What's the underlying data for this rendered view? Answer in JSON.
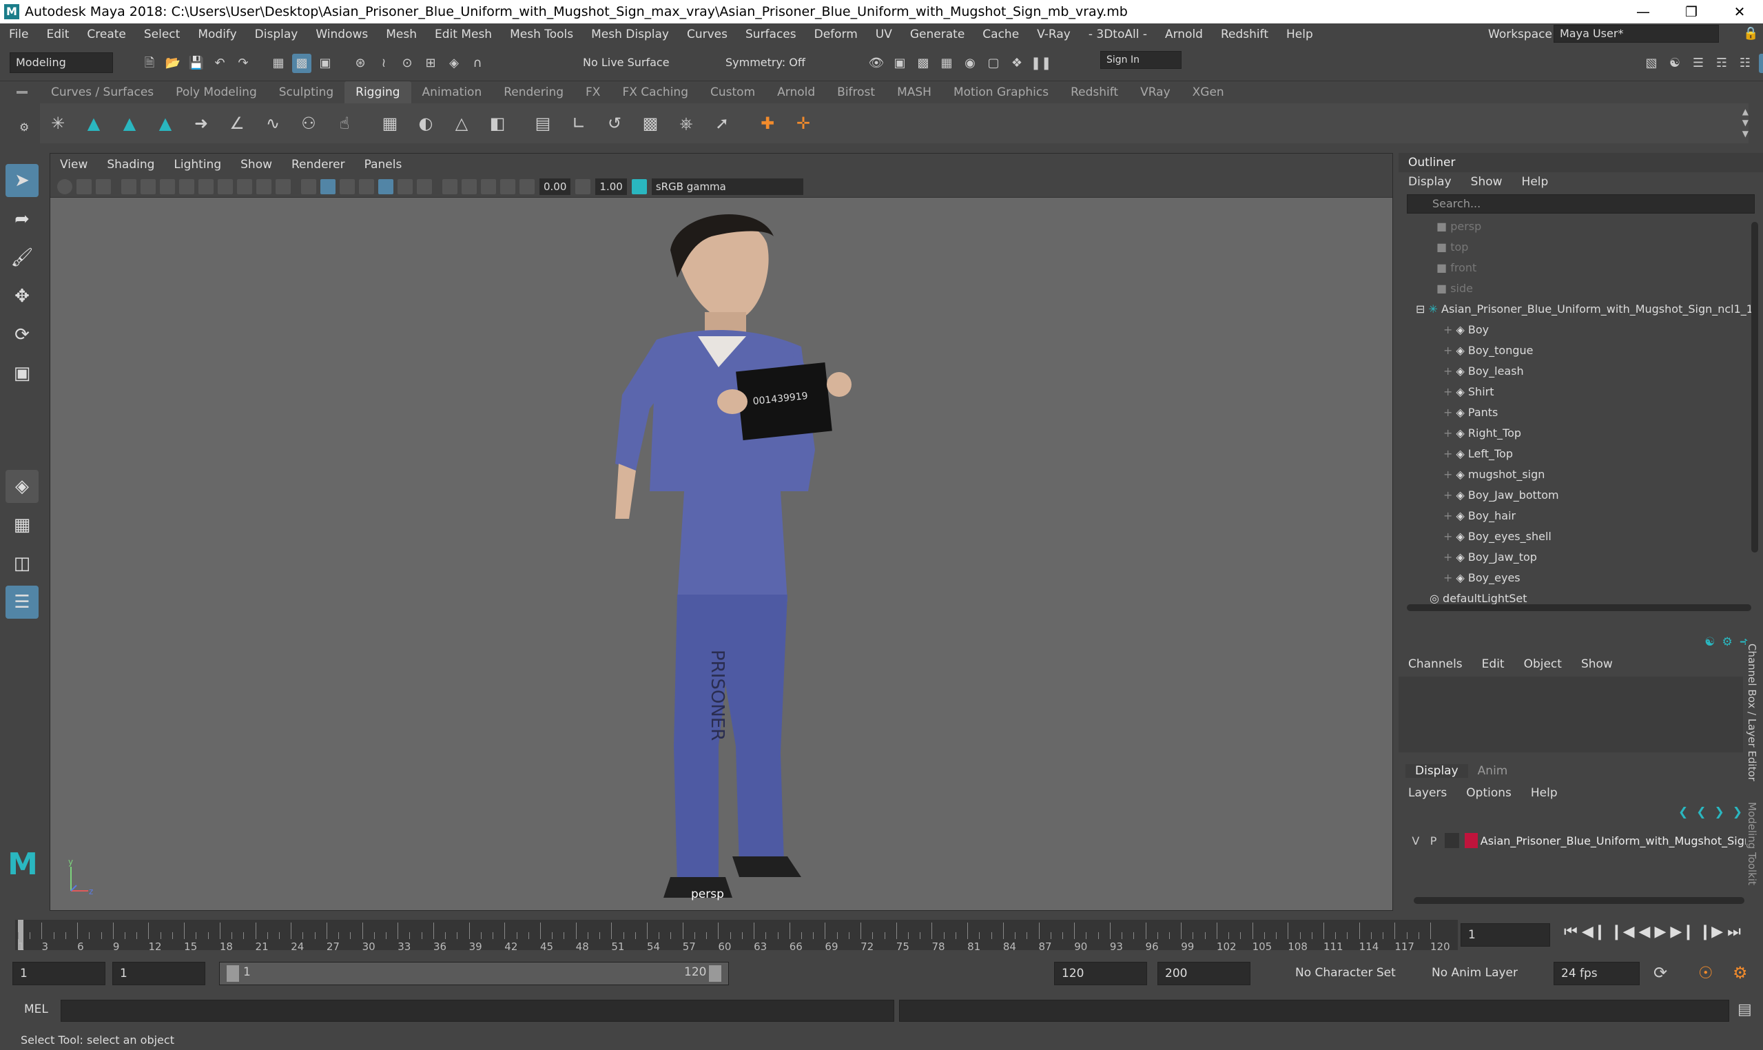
{
  "window": {
    "title": "Autodesk Maya 2018: C:\\Users\\User\\Desktop\\Asian_Prisoner_Blue_Uniform_with_Mugshot_Sign_max_vray\\Asian_Prisoner_Blue_Uniform_with_Mugshot_Sign_mb_vray.mb"
  },
  "menu": [
    "File",
    "Edit",
    "Create",
    "Select",
    "Modify",
    "Display",
    "Windows",
    "Mesh",
    "Edit Mesh",
    "Mesh Tools",
    "Mesh Display",
    "Curves",
    "Surfaces",
    "Deform",
    "UV",
    "Generate",
    "Cache",
    "V-Ray",
    "- 3DtoAll -",
    "Arnold",
    "Redshift",
    "Help"
  ],
  "workspace": {
    "label": "Workspace :",
    "value": "Maya User*"
  },
  "status": {
    "mode": "Modeling",
    "live": "No Live Surface",
    "symmetry": "Symmetry: Off",
    "signin": "Sign In"
  },
  "shelf_tabs": [
    "Curves / Surfaces",
    "Poly Modeling",
    "Sculpting",
    "Rigging",
    "Animation",
    "Rendering",
    "FX",
    "FX Caching",
    "Custom",
    "Arnold",
    "Bifrost",
    "MASH",
    "Motion Graphics",
    "Redshift",
    "VRay",
    "XGen"
  ],
  "shelf_active": "Rigging",
  "viewport": {
    "menu": [
      "View",
      "Shading",
      "Lighting",
      "Show",
      "Renderer",
      "Panels"
    ],
    "exposure": "0.00",
    "gamma": "1.00",
    "colorspace": "sRGB gamma",
    "camera": "persp"
  },
  "outliner": {
    "title": "Outliner",
    "menu": [
      "Display",
      "Show",
      "Help"
    ],
    "search": "Search...",
    "cameras": [
      "persp",
      "top",
      "front",
      "side"
    ],
    "root": "Asian_Prisoner_Blue_Uniform_with_Mugshot_Sign_ncl1_1",
    "children": [
      "Boy",
      "Boy_tongue",
      "Boy_leash",
      "Shirt",
      "Pants",
      "Right_Top",
      "Left_Top",
      "mugshot_sign",
      "Boy_Jaw_bottom",
      "Boy_hair",
      "Boy_eyes_shell",
      "Boy_Jaw_top",
      "Boy_eyes"
    ],
    "last": "defaultLightSet"
  },
  "channels": {
    "menu": [
      "Channels",
      "Edit",
      "Object",
      "Show"
    ]
  },
  "layers": {
    "tabs": [
      "Display",
      "Anim"
    ],
    "menu": [
      "Layers",
      "Options",
      "Help"
    ],
    "v": "V",
    "p": "P",
    "layer": "Asian_Prisoner_Blue_Uniform_with_Mugshot_Sign",
    "color": "#c0143c"
  },
  "side_labels": {
    "channel": "Channel Box / Layer Editor",
    "modeling": "Modeling Toolkit"
  },
  "timeline": {
    "ticks": [
      "1",
      "3",
      "6",
      "9",
      "12",
      "15",
      "18",
      "21",
      "24",
      "27",
      "30",
      "33",
      "36",
      "39",
      "42",
      "45",
      "48",
      "51",
      "54",
      "57",
      "60",
      "63",
      "66",
      "69",
      "72",
      "75",
      "78",
      "81",
      "84",
      "87",
      "90",
      "93",
      "96",
      "99",
      "102",
      "105",
      "108",
      "111",
      "114",
      "117",
      "120"
    ],
    "current": "1"
  },
  "range": {
    "start": "1",
    "start2": "1",
    "bar_start": "1",
    "bar_end": "120",
    "end": "120",
    "end2": "200",
    "charset": "No Character Set",
    "animlayer": "No Anim Layer",
    "fps": "24 fps"
  },
  "cmd": {
    "label": "MEL"
  },
  "help": "Select Tool: select an object"
}
